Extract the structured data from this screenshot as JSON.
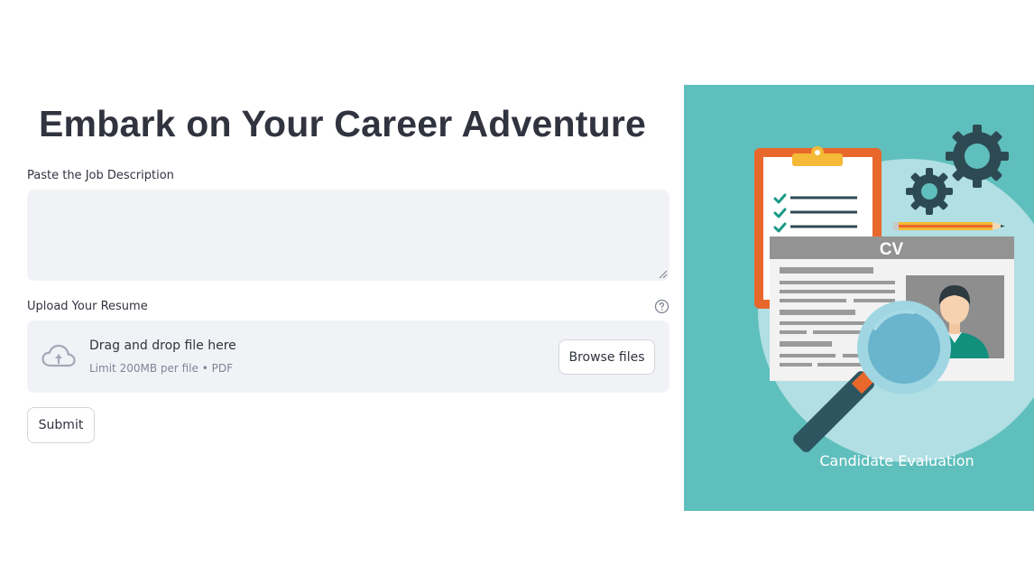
{
  "page": {
    "title": "Embark on Your Career Adventure"
  },
  "job_description": {
    "label": "Paste the Job Description",
    "value": "",
    "placeholder": ""
  },
  "resume_upload": {
    "label": "Upload Your Resume",
    "help_icon": "question-circle-icon",
    "dropzone_title": "Drag and drop file here",
    "dropzone_hint": "Limit 200MB per file • PDF",
    "browse_label": "Browse files",
    "upload_icon": "cloud-upload-icon"
  },
  "submit": {
    "label": "Submit"
  },
  "illustration": {
    "cv_heading": "CV",
    "caption": "Candidate Evaluation",
    "background_color": "#5fbfbc"
  },
  "colors": {
    "text": "#31333f",
    "input_background": "#f0f2f6",
    "muted_text": "#808495",
    "border": "#d3d5da"
  }
}
